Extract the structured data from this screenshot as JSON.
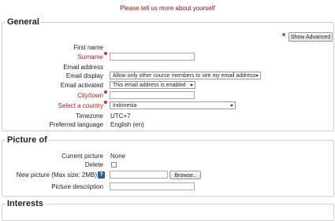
{
  "header": {
    "message": "Please tell us more about yourself"
  },
  "general": {
    "legend": "General",
    "show_advanced_label": "Show Advanced",
    "fields": {
      "first_name": {
        "label": "First name",
        "value": ""
      },
      "surname": {
        "label": "Surname",
        "value": ""
      },
      "email_address": {
        "label": "Email address",
        "value": ""
      },
      "email_display": {
        "label": "Email display",
        "selected": "Allow only other course members to see my email address"
      },
      "email_activated": {
        "label": "Email activated",
        "selected": "This email address is enabled"
      },
      "city": {
        "label": "City/town",
        "value": ""
      },
      "country": {
        "label": "Select a country",
        "selected": "Indonesia"
      },
      "timezone": {
        "label": "Timezone",
        "value": "UTC+7"
      },
      "preferred_language": {
        "label": "Preferred language",
        "value": "English (en)"
      }
    }
  },
  "picture": {
    "legend": "Picture of",
    "fields": {
      "current_picture": {
        "label": "Current picture",
        "value": "None"
      },
      "delete": {
        "label": "Delete",
        "checked": false
      },
      "new_picture": {
        "label": "New picture (Max size: 2MB)",
        "help_icon": "?",
        "browse_label": "Browse..",
        "value": ""
      },
      "picture_description": {
        "label": "Picture description",
        "value": ""
      }
    }
  },
  "interests": {
    "legend": "Interests"
  },
  "colors": {
    "required": "#b01e1e",
    "header_message": "#8b0f0f",
    "help_icon_bg": "#2b5f8a",
    "advanced_dot": "#3c9a2f"
  },
  "icons": {
    "required_marker": "required-icon",
    "help": "help-icon",
    "advanced": "green-dot-icon"
  }
}
